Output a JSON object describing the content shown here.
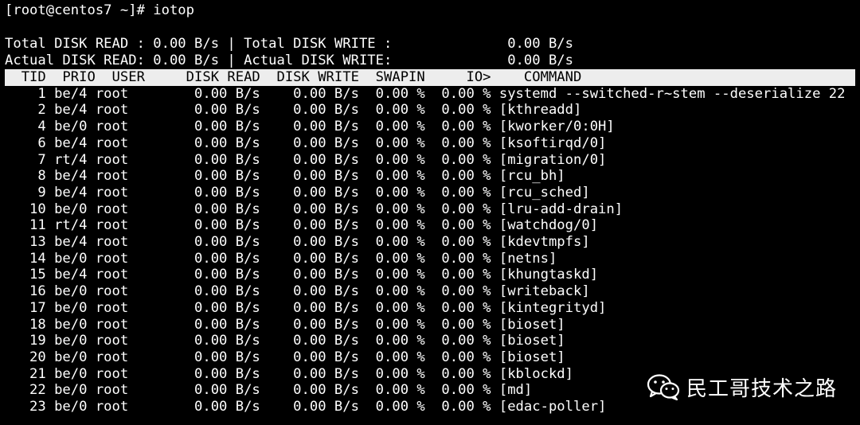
{
  "prompt": "[root@centos7 ~]# iotop",
  "summary": {
    "total": "Total DISK READ : 0.00 B/s | Total DISK WRITE :              0.00 B/s",
    "actual": "Actual DISK READ: 0.00 B/s | Actual DISK WRITE:              0.00 B/s"
  },
  "table": {
    "header": "  TID  PRIO  USER     DISK READ  DISK WRITE  SWAPIN     IO>    COMMAND",
    "rows": [
      {
        "tid": "1",
        "prio": "be/4",
        "user": "root",
        "read": "0.00 B/s",
        "write": "0.00 B/s",
        "swapin": "0.00 %",
        "io": "0.00 %",
        "command": "systemd --switched-r~stem --deserialize 22"
      },
      {
        "tid": "2",
        "prio": "be/4",
        "user": "root",
        "read": "0.00 B/s",
        "write": "0.00 B/s",
        "swapin": "0.00 %",
        "io": "0.00 %",
        "command": "[kthreadd]"
      },
      {
        "tid": "4",
        "prio": "be/0",
        "user": "root",
        "read": "0.00 B/s",
        "write": "0.00 B/s",
        "swapin": "0.00 %",
        "io": "0.00 %",
        "command": "[kworker/0:0H]"
      },
      {
        "tid": "6",
        "prio": "be/4",
        "user": "root",
        "read": "0.00 B/s",
        "write": "0.00 B/s",
        "swapin": "0.00 %",
        "io": "0.00 %",
        "command": "[ksoftirqd/0]"
      },
      {
        "tid": "7",
        "prio": "rt/4",
        "user": "root",
        "read": "0.00 B/s",
        "write": "0.00 B/s",
        "swapin": "0.00 %",
        "io": "0.00 %",
        "command": "[migration/0]"
      },
      {
        "tid": "8",
        "prio": "be/4",
        "user": "root",
        "read": "0.00 B/s",
        "write": "0.00 B/s",
        "swapin": "0.00 %",
        "io": "0.00 %",
        "command": "[rcu_bh]"
      },
      {
        "tid": "9",
        "prio": "be/4",
        "user": "root",
        "read": "0.00 B/s",
        "write": "0.00 B/s",
        "swapin": "0.00 %",
        "io": "0.00 %",
        "command": "[rcu_sched]"
      },
      {
        "tid": "10",
        "prio": "be/0",
        "user": "root",
        "read": "0.00 B/s",
        "write": "0.00 B/s",
        "swapin": "0.00 %",
        "io": "0.00 %",
        "command": "[lru-add-drain]"
      },
      {
        "tid": "11",
        "prio": "rt/4",
        "user": "root",
        "read": "0.00 B/s",
        "write": "0.00 B/s",
        "swapin": "0.00 %",
        "io": "0.00 %",
        "command": "[watchdog/0]"
      },
      {
        "tid": "13",
        "prio": "be/4",
        "user": "root",
        "read": "0.00 B/s",
        "write": "0.00 B/s",
        "swapin": "0.00 %",
        "io": "0.00 %",
        "command": "[kdevtmpfs]"
      },
      {
        "tid": "14",
        "prio": "be/0",
        "user": "root",
        "read": "0.00 B/s",
        "write": "0.00 B/s",
        "swapin": "0.00 %",
        "io": "0.00 %",
        "command": "[netns]"
      },
      {
        "tid": "15",
        "prio": "be/4",
        "user": "root",
        "read": "0.00 B/s",
        "write": "0.00 B/s",
        "swapin": "0.00 %",
        "io": "0.00 %",
        "command": "[khungtaskd]"
      },
      {
        "tid": "16",
        "prio": "be/0",
        "user": "root",
        "read": "0.00 B/s",
        "write": "0.00 B/s",
        "swapin": "0.00 %",
        "io": "0.00 %",
        "command": "[writeback]"
      },
      {
        "tid": "17",
        "prio": "be/0",
        "user": "root",
        "read": "0.00 B/s",
        "write": "0.00 B/s",
        "swapin": "0.00 %",
        "io": "0.00 %",
        "command": "[kintegrityd]"
      },
      {
        "tid": "18",
        "prio": "be/0",
        "user": "root",
        "read": "0.00 B/s",
        "write": "0.00 B/s",
        "swapin": "0.00 %",
        "io": "0.00 %",
        "command": "[bioset]"
      },
      {
        "tid": "19",
        "prio": "be/0",
        "user": "root",
        "read": "0.00 B/s",
        "write": "0.00 B/s",
        "swapin": "0.00 %",
        "io": "0.00 %",
        "command": "[bioset]"
      },
      {
        "tid": "20",
        "prio": "be/0",
        "user": "root",
        "read": "0.00 B/s",
        "write": "0.00 B/s",
        "swapin": "0.00 %",
        "io": "0.00 %",
        "command": "[bioset]"
      },
      {
        "tid": "21",
        "prio": "be/0",
        "user": "root",
        "read": "0.00 B/s",
        "write": "0.00 B/s",
        "swapin": "0.00 %",
        "io": "0.00 %",
        "command": "[kblockd]"
      },
      {
        "tid": "22",
        "prio": "be/0",
        "user": "root",
        "read": "0.00 B/s",
        "write": "0.00 B/s",
        "swapin": "0.00 %",
        "io": "0.00 %",
        "command": "[md]"
      },
      {
        "tid": "23",
        "prio": "be/0",
        "user": "root",
        "read": "0.00 B/s",
        "write": "0.00 B/s",
        "swapin": "0.00 %",
        "io": "0.00 %",
        "command": "[edac-poller]"
      }
    ]
  },
  "watermark": {
    "icon": "wechat-icon",
    "text": "民工哥技术之路"
  },
  "colors": {
    "background": "#000000",
    "foreground": "#ffffff",
    "header_bg": "#ededed",
    "header_fg": "#000000"
  }
}
